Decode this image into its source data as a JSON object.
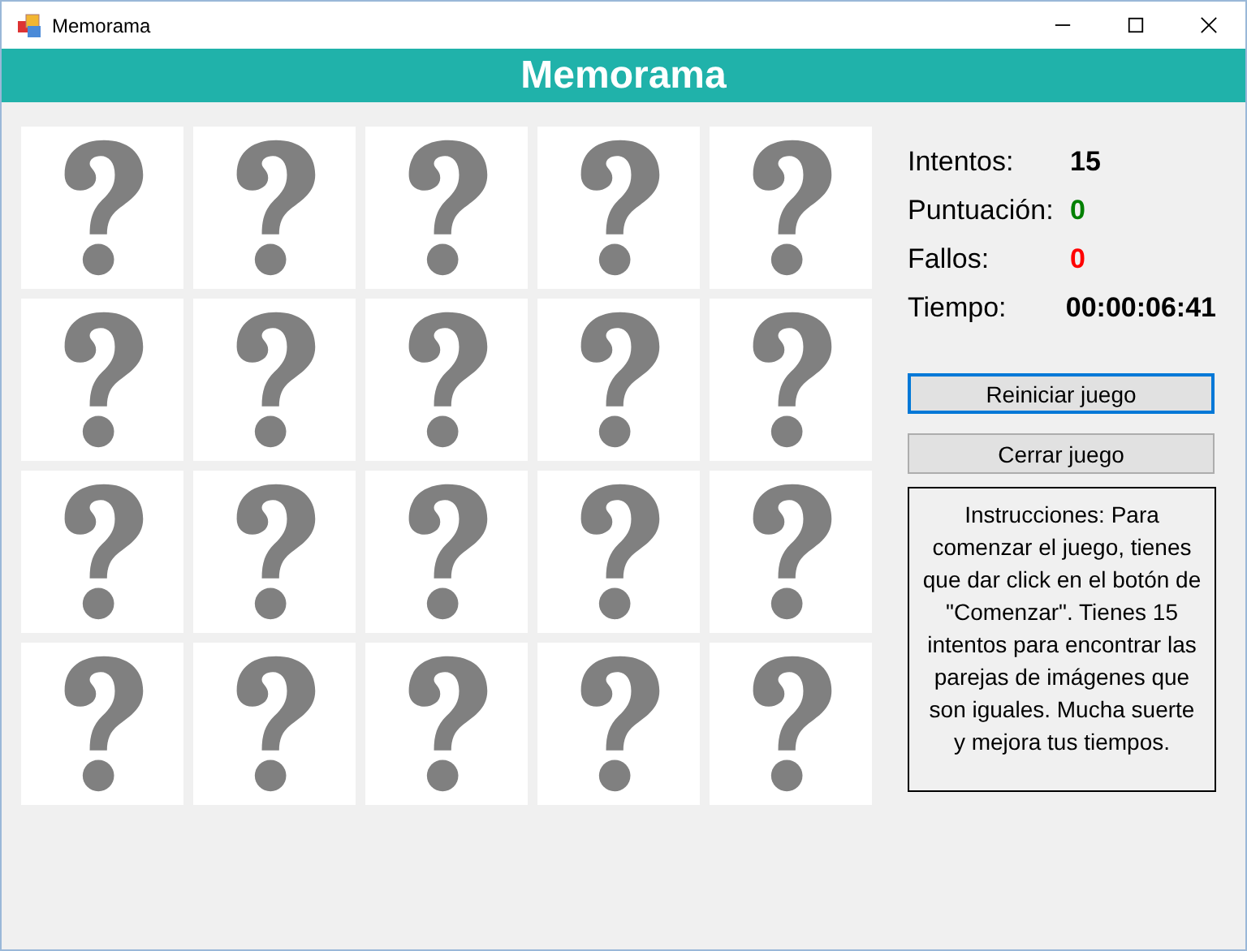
{
  "window": {
    "title": "Memorama"
  },
  "header": {
    "title": "Memorama"
  },
  "cards": [
    {
      "kind": "hidden"
    },
    {
      "kind": "hidden"
    },
    {
      "kind": "hidden"
    },
    {
      "kind": "hidden"
    },
    {
      "kind": "hidden"
    },
    {
      "kind": "hidden"
    },
    {
      "kind": "hidden"
    },
    {
      "kind": "hidden"
    },
    {
      "kind": "hidden"
    },
    {
      "kind": "hidden"
    },
    {
      "kind": "hidden"
    },
    {
      "kind": "hidden"
    },
    {
      "kind": "hidden"
    },
    {
      "kind": "hidden"
    },
    {
      "kind": "hidden"
    },
    {
      "kind": "hidden"
    },
    {
      "kind": "hidden"
    },
    {
      "kind": "hidden"
    },
    {
      "kind": "hidden"
    },
    {
      "kind": "hidden"
    }
  ],
  "stats": [
    {
      "label": "Intentos:",
      "value": "15",
      "color": "#000000"
    },
    {
      "label": "Puntuación:",
      "value": "0",
      "color": "#008000"
    },
    {
      "label": "Fallos:",
      "value": "0",
      "color": "#ff0000"
    },
    {
      "label": "Tiempo:",
      "value": "00:00:06:41",
      "color": "#000000"
    }
  ],
  "buttons": [
    {
      "label": "Reiniciar juego",
      "focused": true
    },
    {
      "label": "Cerrar juego",
      "focused": false
    }
  ],
  "instructions": "Instrucciones: Para comenzar el juego, tienes que dar click en el botón de \"Comenzar\". Tienes 15 intentos para encontrar las parejas de imágenes que son iguales. Mucha suerte y mejora tus tiempos."
}
